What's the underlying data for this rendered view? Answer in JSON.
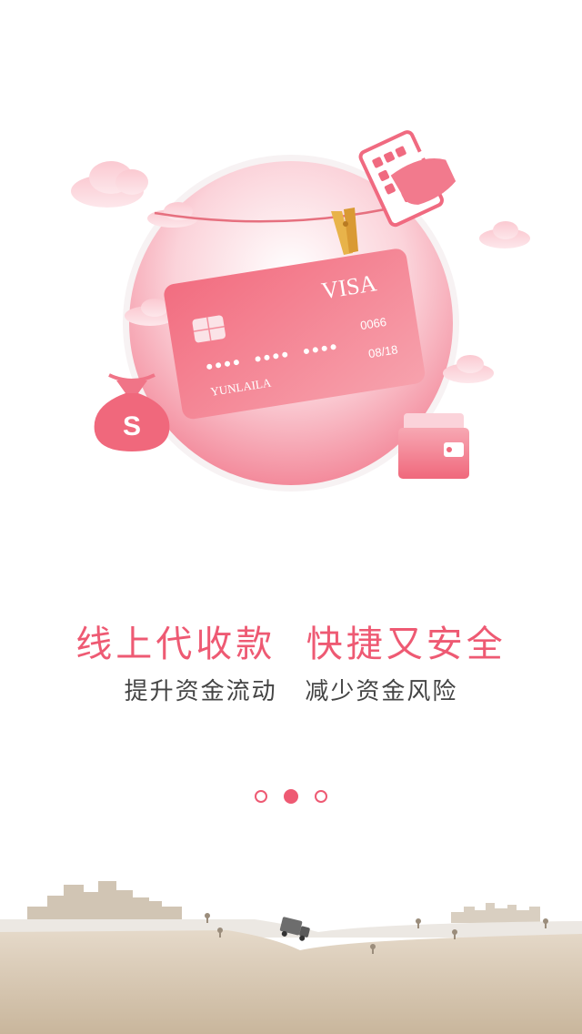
{
  "colors": {
    "accent": "#ee5a73",
    "subtitle": "#444444",
    "card_start": "#f26d80",
    "card_end": "#f9a3ad",
    "ground": "#d8c9b5"
  },
  "card": {
    "brand": "VISA",
    "number_tail": "0066",
    "expiry": "08/18",
    "holder": "YUNLAILA"
  },
  "bag_symbol": "S",
  "headline": "线上代收款  快捷又安全",
  "subline": "提升资金流动   减少资金风险",
  "pager": {
    "count": 3,
    "active_index": 1
  }
}
